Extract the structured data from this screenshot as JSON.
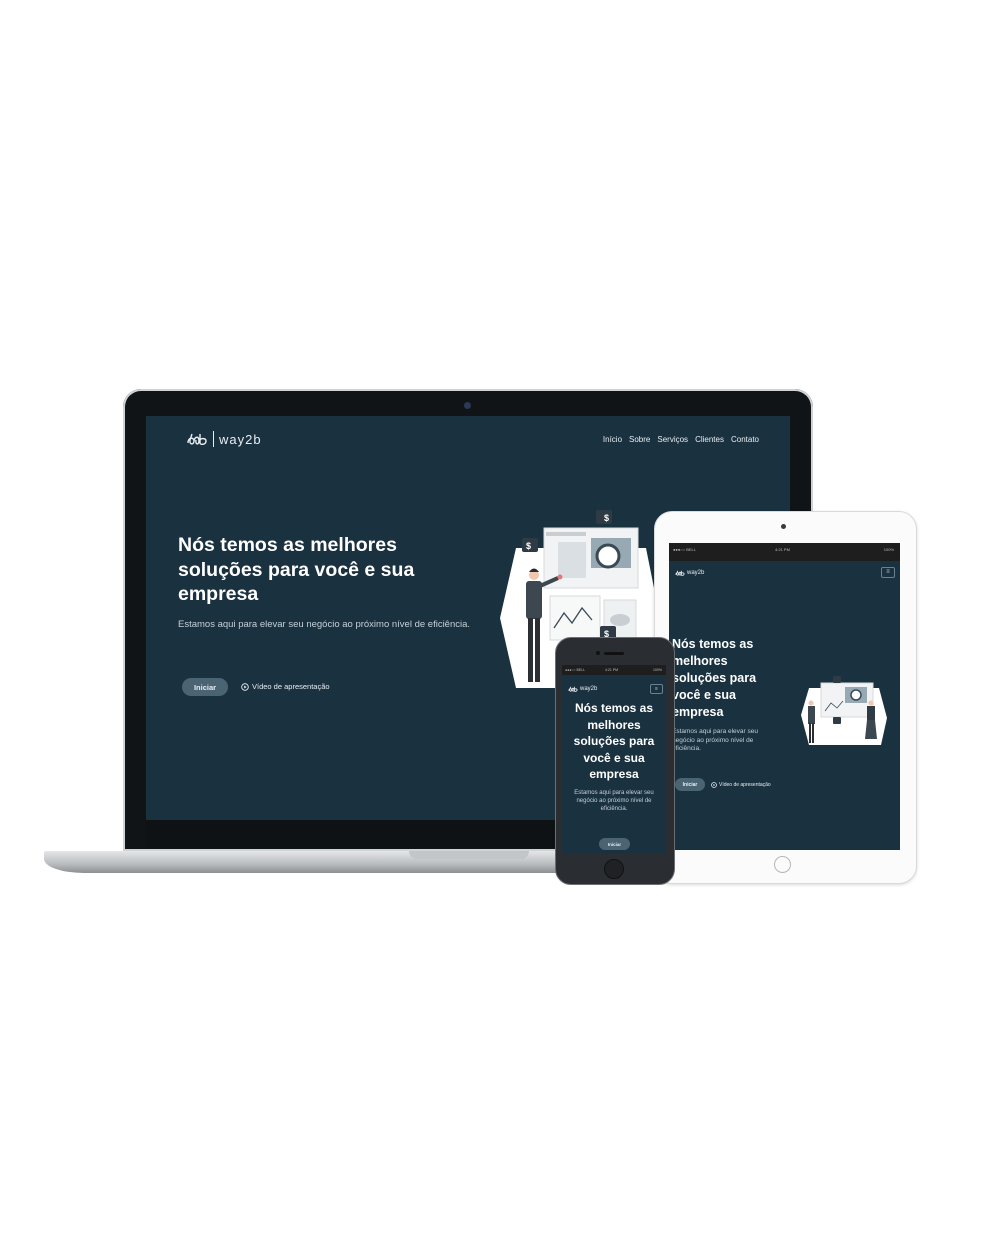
{
  "desktop": {
    "logo_text": "way2b",
    "nav": [
      "Início",
      "Sobre",
      "Serviços",
      "Clientes",
      "Contato"
    ],
    "hero_title": "Nós temos as melhores soluções para você e sua empresa",
    "hero_subtitle": "Estamos aqui para elevar seu negócio ao próximo nível de eficiência.",
    "cta_label": "Iniciar",
    "video_label": "Vídeo de apresentação"
  },
  "tablet": {
    "status_carrier": "●●●○○ BELL",
    "status_time": "4:21 PM",
    "status_battery": "100%",
    "logo_text": "way2b",
    "menu_icon": "≡",
    "hero_title": "Nós temos as melhores soluções para você e sua empresa",
    "hero_subtitle": "Estamos aqui para elevar seu negócio ao próximo nível de eficiência.",
    "cta_label": "Iniciar",
    "video_label": "Vídeo de apresentação"
  },
  "phone": {
    "status_carrier": "●●●○○ BELL",
    "status_time": "4:21 PM",
    "status_battery": "100%",
    "logo_text": "way2b",
    "menu_icon": "≡",
    "hero_title": "Nós temos as melhores soluções para você e sua empresa",
    "hero_subtitle": "Estamos aqui para elevar seu negócio ao próximo nível de eficiência.",
    "cta_label": "Iniciar"
  },
  "illustration": {
    "currency_symbol": "$"
  },
  "colors": {
    "hero_background": "#1a3140",
    "button_background": "#4a6474",
    "text_light": "#e8eef1"
  }
}
